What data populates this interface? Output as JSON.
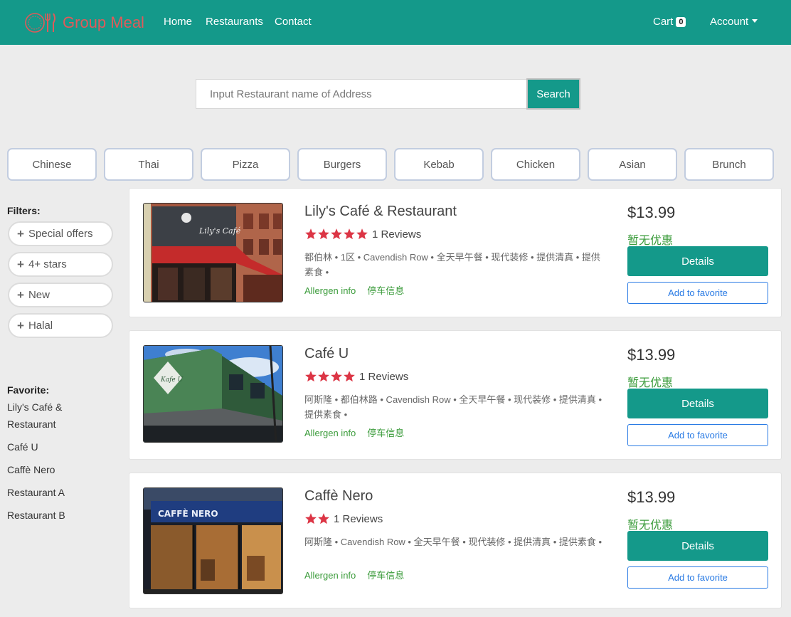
{
  "nav": {
    "brand": "Group Meal",
    "links": [
      "Home",
      "Restaurants",
      "Contact"
    ],
    "cart_label": "Cart",
    "cart_count": "0",
    "account_label": "Account"
  },
  "search": {
    "placeholder": "Input Restaurant name of Address",
    "button": "Search"
  },
  "categories": [
    "Chinese",
    "Thai",
    "Pizza",
    "Burgers",
    "Kebab",
    "Chicken",
    "Asian",
    "Brunch"
  ],
  "sidebar": {
    "filters_title": "Filters:",
    "filters": [
      "Special offers",
      "4+ stars",
      "New",
      "Halal"
    ],
    "favorite_title": "Favorite:",
    "favorites": [
      "Lily's Café & Restaurant",
      "Café U",
      "Caffè Nero",
      "Restaurant A",
      "Restaurant B"
    ]
  },
  "restaurants": [
    {
      "name": "Lily's Café & Restaurant",
      "stars": 5,
      "reviews": "1 Reviews",
      "tags": "都伯林 • 1区 • Cavendish Row • 全天早午餐 • 现代装修 • 提供清真 • 提供素食 •",
      "allergen": "Allergen info",
      "parking": "停车信息",
      "price": "$13.99",
      "promo": "暂无优惠",
      "details": "Details",
      "favorite": "Add to favorite"
    },
    {
      "name": "Café U",
      "stars": 4,
      "reviews": "1 Reviews",
      "tags": "阿斯隆 • 都伯林路 • Cavendish Row • 全天早午餐 • 现代装修 • 提供清真 • 提供素食 •",
      "allergen": "Allergen info",
      "parking": "停车信息",
      "price": "$13.99",
      "promo": "暂无优惠",
      "details": "Details",
      "favorite": "Add to favorite"
    },
    {
      "name": "Caffè Nero",
      "stars": 2,
      "reviews": "1 Reviews",
      "tags": "阿斯隆 • Cavendish Row • 全天早午餐 • 现代装修 • 提供清真 • 提供素食 •",
      "allergen": "Allergen info",
      "parking": "停车信息",
      "price": "$13.99",
      "promo": "暂无优惠",
      "details": "Details",
      "favorite": "Add to favorite"
    }
  ],
  "colors": {
    "primary": "#14998a",
    "brand_text": "#e05a5a",
    "star": "#dc3545",
    "green_text": "#3a9b3a",
    "link_blue": "#2a7be4"
  }
}
